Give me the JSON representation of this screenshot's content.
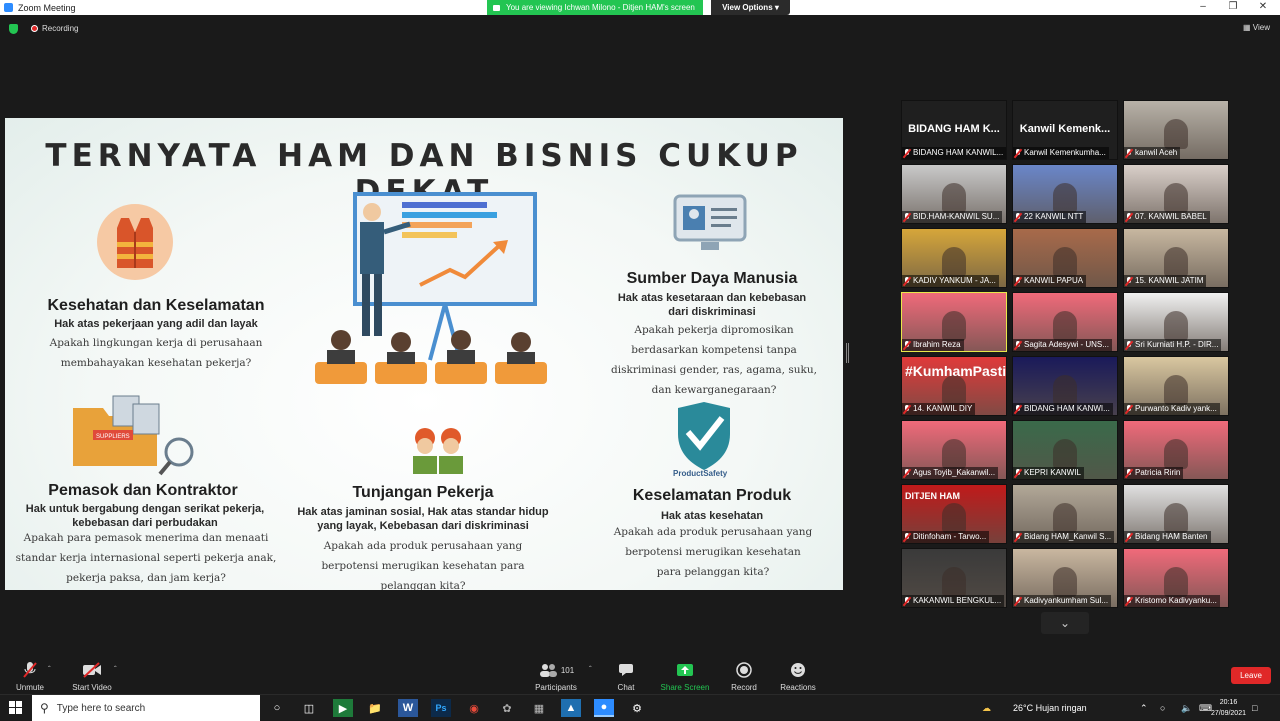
{
  "window": {
    "title": "Zoom Meeting",
    "controls": [
      "–",
      "❐",
      "✕"
    ]
  },
  "share_banner": {
    "text": "You are viewing Ichwan Milono - Ditjen HAM's screen",
    "view_options": "View Options ▾"
  },
  "topbar": {
    "recording": "Recording",
    "view": "View"
  },
  "slide": {
    "title": "TERNYATA HAM DAN BISNIS CUKUP DEKAT",
    "sections": {
      "kesehatan": {
        "heading": "Kesehatan dan Keselamatan",
        "sub": "Hak atas pekerjaan yang adil dan layak",
        "body": "Apakah lingkungan kerja di perusahaan membahayakan kesehatan pekerja?"
      },
      "sdm": {
        "heading": "Sumber Daya Manusia",
        "sub": "Hak atas kesetaraan dan kebebasan dari diskriminasi",
        "body": "Apakah pekerja dipromosikan berdasarkan kompetensi tanpa diskriminasi gender, ras, agama, suku, dan kewarganegaraan?"
      },
      "pemasok": {
        "heading": "Pemasok dan Kontraktor",
        "sub": "Hak untuk bergabung dengan serikat pekerja, kebebasan dari perbudakan",
        "body": "Apakah para pemasok menerima dan menaati standar kerja internasional seperti pekerja anak, pekerja paksa, dan jam kerja?"
      },
      "tunjangan": {
        "heading": "Tunjangan Pekerja",
        "sub": "Hak atas jaminan sosial, Hak atas standar hidup yang layak, Kebebasan dari diskriminasi",
        "body": "Apakah ada produk perusahaan yang berpotensi merugikan kesehatan para pelanggan kita?"
      },
      "produk": {
        "heading": "Keselamatan Produk",
        "sub": "Hak atas kesehatan",
        "body": "Apakah ada produk perusahaan yang berpotensi merugikan kesehatan para pelanggan kita?"
      }
    },
    "supplier_tag": "SUPPLIERS",
    "product_safety_label": "ProductSafety"
  },
  "gallery": [
    {
      "big": "BIDANG HAM K...",
      "label": "BIDANG HAM KANWIL..."
    },
    {
      "big": "Kanwil Kemenk...",
      "label": "Kanwil Kemenkumha..."
    },
    {
      "label": "kanwil Aceh"
    },
    {
      "label": "BID.HAM-KANWIL SU..."
    },
    {
      "label": "22 KANWIL NTT"
    },
    {
      "label": "07. KANWIL BABEL"
    },
    {
      "label": "KADIV YANKUM - JA..."
    },
    {
      "label": "KANWIL PAPUA"
    },
    {
      "label": "15. KANWIL JATIM"
    },
    {
      "label": "Ibrahim Reza"
    },
    {
      "label": "Sagita Adesywi - UNS..."
    },
    {
      "label": "Sri Kurniati H.P. - DIR..."
    },
    {
      "label": "14. KANWIL DIY",
      "tag": "#KumhamPasti"
    },
    {
      "label": "BIDANG HAM KANWI..."
    },
    {
      "label": "Purwanto Kadiv yank..."
    },
    {
      "label": "Agus Toyib_Kakanwil..."
    },
    {
      "label": "KEPRI KANWIL"
    },
    {
      "label": "Patricia Ririn"
    },
    {
      "label": "Ditinfoham - Tarwo...",
      "tag": "DITJEN HAM"
    },
    {
      "label": "Bidang HAM_Kanwil S..."
    },
    {
      "label": "Bidang HAM Banten"
    },
    {
      "label": "KAKANWIL BENGKUL..."
    },
    {
      "label": "Kadivyankumham Sul..."
    },
    {
      "label": "Kristomo Kadivyanku..."
    }
  ],
  "controls": {
    "unmute": "Unmute",
    "start_video": "Start Video",
    "participants": "Participants",
    "participants_count": "101",
    "chat": "Chat",
    "share_screen": "Share Screen",
    "record": "Record",
    "reactions": "Reactions",
    "leave": "Leave"
  },
  "taskbar": {
    "search_placeholder": "Type here to search",
    "weather": "26°C  Hujan ringan",
    "time": "20:16",
    "date": "27/09/2021"
  },
  "colors": {
    "zoom_green": "#23c552",
    "leave_red": "#e02828",
    "share_green": "#23c552",
    "speaker_outline": "#e8e84a"
  }
}
